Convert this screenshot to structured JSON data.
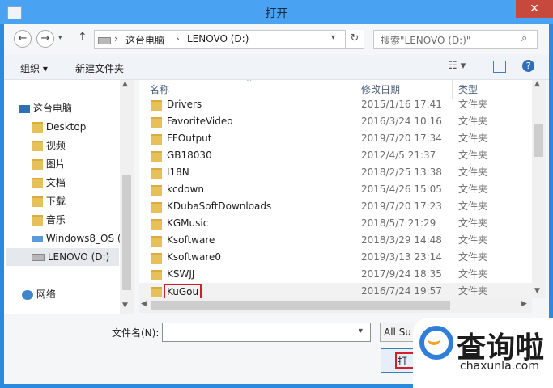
{
  "window": {
    "title": "打开",
    "close": "✕"
  },
  "address": {
    "crumbs": [
      "这台电脑",
      "LENOVO (D:)"
    ],
    "search_placeholder": "搜索\"LENOVO (D:)\""
  },
  "toolbar": {
    "organize": "组织 ▾",
    "new_folder": "新建文件夹"
  },
  "sidebar": {
    "items": [
      {
        "label": "这台电脑"
      },
      {
        "label": "Desktop"
      },
      {
        "label": "视频"
      },
      {
        "label": "图片"
      },
      {
        "label": "文档"
      },
      {
        "label": "下载"
      },
      {
        "label": "音乐"
      },
      {
        "label": "Windows8_OS ("
      },
      {
        "label": "LENOVO (D:)"
      },
      {
        "label": "网络"
      }
    ]
  },
  "columns": {
    "name": "名称",
    "date": "修改日期",
    "type": "类型"
  },
  "files": [
    {
      "name": "Drivers",
      "date": "2015/1/16 17:41",
      "type": "文件夹"
    },
    {
      "name": "FavoriteVideo",
      "date": "2016/3/24 10:16",
      "type": "文件夹"
    },
    {
      "name": "FFOutput",
      "date": "2019/7/20 17:34",
      "type": "文件夹"
    },
    {
      "name": "GB18030",
      "date": "2012/4/5 21:37",
      "type": "文件夹"
    },
    {
      "name": "I18N",
      "date": "2018/2/25 13:38",
      "type": "文件夹"
    },
    {
      "name": "kcdown",
      "date": "2015/4/26 15:05",
      "type": "文件夹"
    },
    {
      "name": "KDubaSoftDownloads",
      "date": "2019/7/20 17:23",
      "type": "文件夹"
    },
    {
      "name": "KGMusic",
      "date": "2018/5/7 21:29",
      "type": "文件夹"
    },
    {
      "name": "Ksoftware",
      "date": "2018/3/29 14:48",
      "type": "文件夹"
    },
    {
      "name": "Ksoftware0",
      "date": "2019/3/13 23:14",
      "type": "文件夹"
    },
    {
      "name": "KSWJJ",
      "date": "2017/9/24 18:35",
      "type": "文件夹"
    },
    {
      "name": "KuGou",
      "date": "2016/7/24 19:57",
      "type": "文件夹"
    }
  ],
  "bottom": {
    "filename_label": "文件名(N):",
    "filter": "All Su",
    "open": "打"
  },
  "watermark": {
    "cn": "查询啦",
    "url": "chaxunla.com"
  },
  "colors": {
    "accent": "#4aa3f2",
    "highlight": "#d0202b"
  }
}
